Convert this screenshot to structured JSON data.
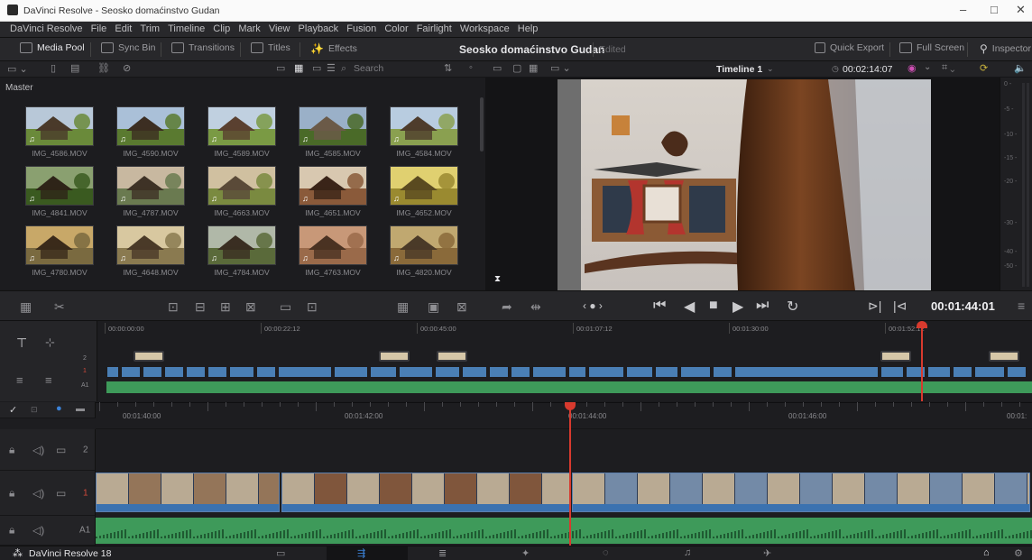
{
  "window": {
    "title": "DaVinci Resolve - Seosko domaćinstvo Gudan",
    "min": "–",
    "max": "□",
    "close": "✕"
  },
  "menu": [
    "DaVinci Resolve",
    "File",
    "Edit",
    "Trim",
    "Timeline",
    "Clip",
    "Mark",
    "View",
    "Playback",
    "Fusion",
    "Color",
    "Fairlight",
    "Workspace",
    "Help"
  ],
  "toolbar": {
    "media_pool": "Media Pool",
    "sync_bin": "Sync Bin",
    "transitions": "Transitions",
    "titles": "Titles",
    "effects": "Effects",
    "project_title": "Seosko domaćinstvo Gudan",
    "edited": "Edited",
    "quick_export": "Quick Export",
    "full_screen": "Full Screen",
    "inspector": "Inspector"
  },
  "media_pool": {
    "search_placeholder": "Search",
    "bin": "Master",
    "clips": [
      {
        "name": "IMG_4586.MOV"
      },
      {
        "name": "IMG_4590.MOV"
      },
      {
        "name": "IMG_4589.MOV"
      },
      {
        "name": "IMG_4585.MOV"
      },
      {
        "name": "IMG_4584.MOV"
      },
      {
        "name": "IMG_4841.MOV"
      },
      {
        "name": "IMG_4787.MOV"
      },
      {
        "name": "IMG_4663.MOV"
      },
      {
        "name": "IMG_4651.MOV"
      },
      {
        "name": "IMG_4652.MOV"
      },
      {
        "name": "IMG_4780.MOV"
      },
      {
        "name": "IMG_4648.MOV"
      },
      {
        "name": "IMG_4784.MOV"
      },
      {
        "name": "IMG_4763.MOV"
      },
      {
        "name": "IMG_4820.MOV"
      }
    ]
  },
  "viewer": {
    "timeline_name": "Timeline 1",
    "duration": "00:02:14:07",
    "timecode": "00:01:44:01"
  },
  "meter_scale": [
    "0 -",
    "-5 -",
    "-10 -",
    "-15 -",
    "-20 -",
    "-30 -",
    "-40 -",
    "-50 -"
  ],
  "upper_timeline": {
    "ruler": [
      "00:00:00:00",
      "00:00:22:12",
      "00:00:45:00",
      "00:01:07:12",
      "00:01:30:00",
      "00:01:52:12"
    ],
    "tracks": [
      "2",
      "1",
      "A1"
    ],
    "playhead_fraction": 0.9
  },
  "lower_timeline": {
    "ruler": [
      "00:01:40:00",
      "00:01:42:00",
      "00:01:44:00",
      "00:01:46:00",
      "00:01:"
    ],
    "tracks": [
      {
        "id": "2",
        "type": "video"
      },
      {
        "id": "1",
        "type": "video"
      },
      {
        "id": "A1",
        "type": "audio"
      }
    ]
  },
  "footer": {
    "app": "DaVinci Resolve 18"
  }
}
